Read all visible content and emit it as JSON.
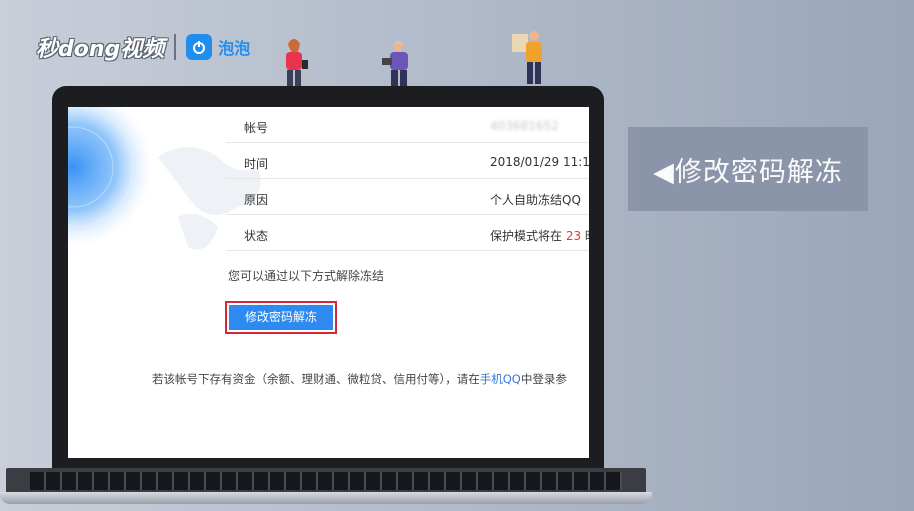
{
  "brand": {
    "logo_text": "秒dong视频",
    "partner_text": "泡泡"
  },
  "caption": {
    "text": "◀修改密码解冻"
  },
  "info": {
    "rows": [
      {
        "label": "帐号",
        "value": "403681652",
        "value_style": "blurred"
      },
      {
        "label": "时间",
        "value": "2018/01/29  11:1",
        "value_style": "normal"
      },
      {
        "label": "原因",
        "value": "个人自助冻结QQ",
        "value_style": "normal"
      },
      {
        "label": "状态",
        "value_prefix": "保护模式将在 ",
        "value_highlight": "23",
        "value_suffix": " 时",
        "value_style": "normal"
      }
    ],
    "hint": "您可以通过以下方式解除冻结",
    "button_label": "修改密码解冻",
    "note_prefix": "若该帐号下存有资金（余额、理财通、微粒贷、信用付等），请在",
    "note_link": "手机QQ",
    "note_suffix": "中登录参"
  },
  "colors": {
    "button_blue": "#2d8af0",
    "highlight_border": "#d6263b",
    "status_red": "#e23b3b",
    "link_blue": "#3876d9",
    "caption_bg": "#8a94a8"
  }
}
